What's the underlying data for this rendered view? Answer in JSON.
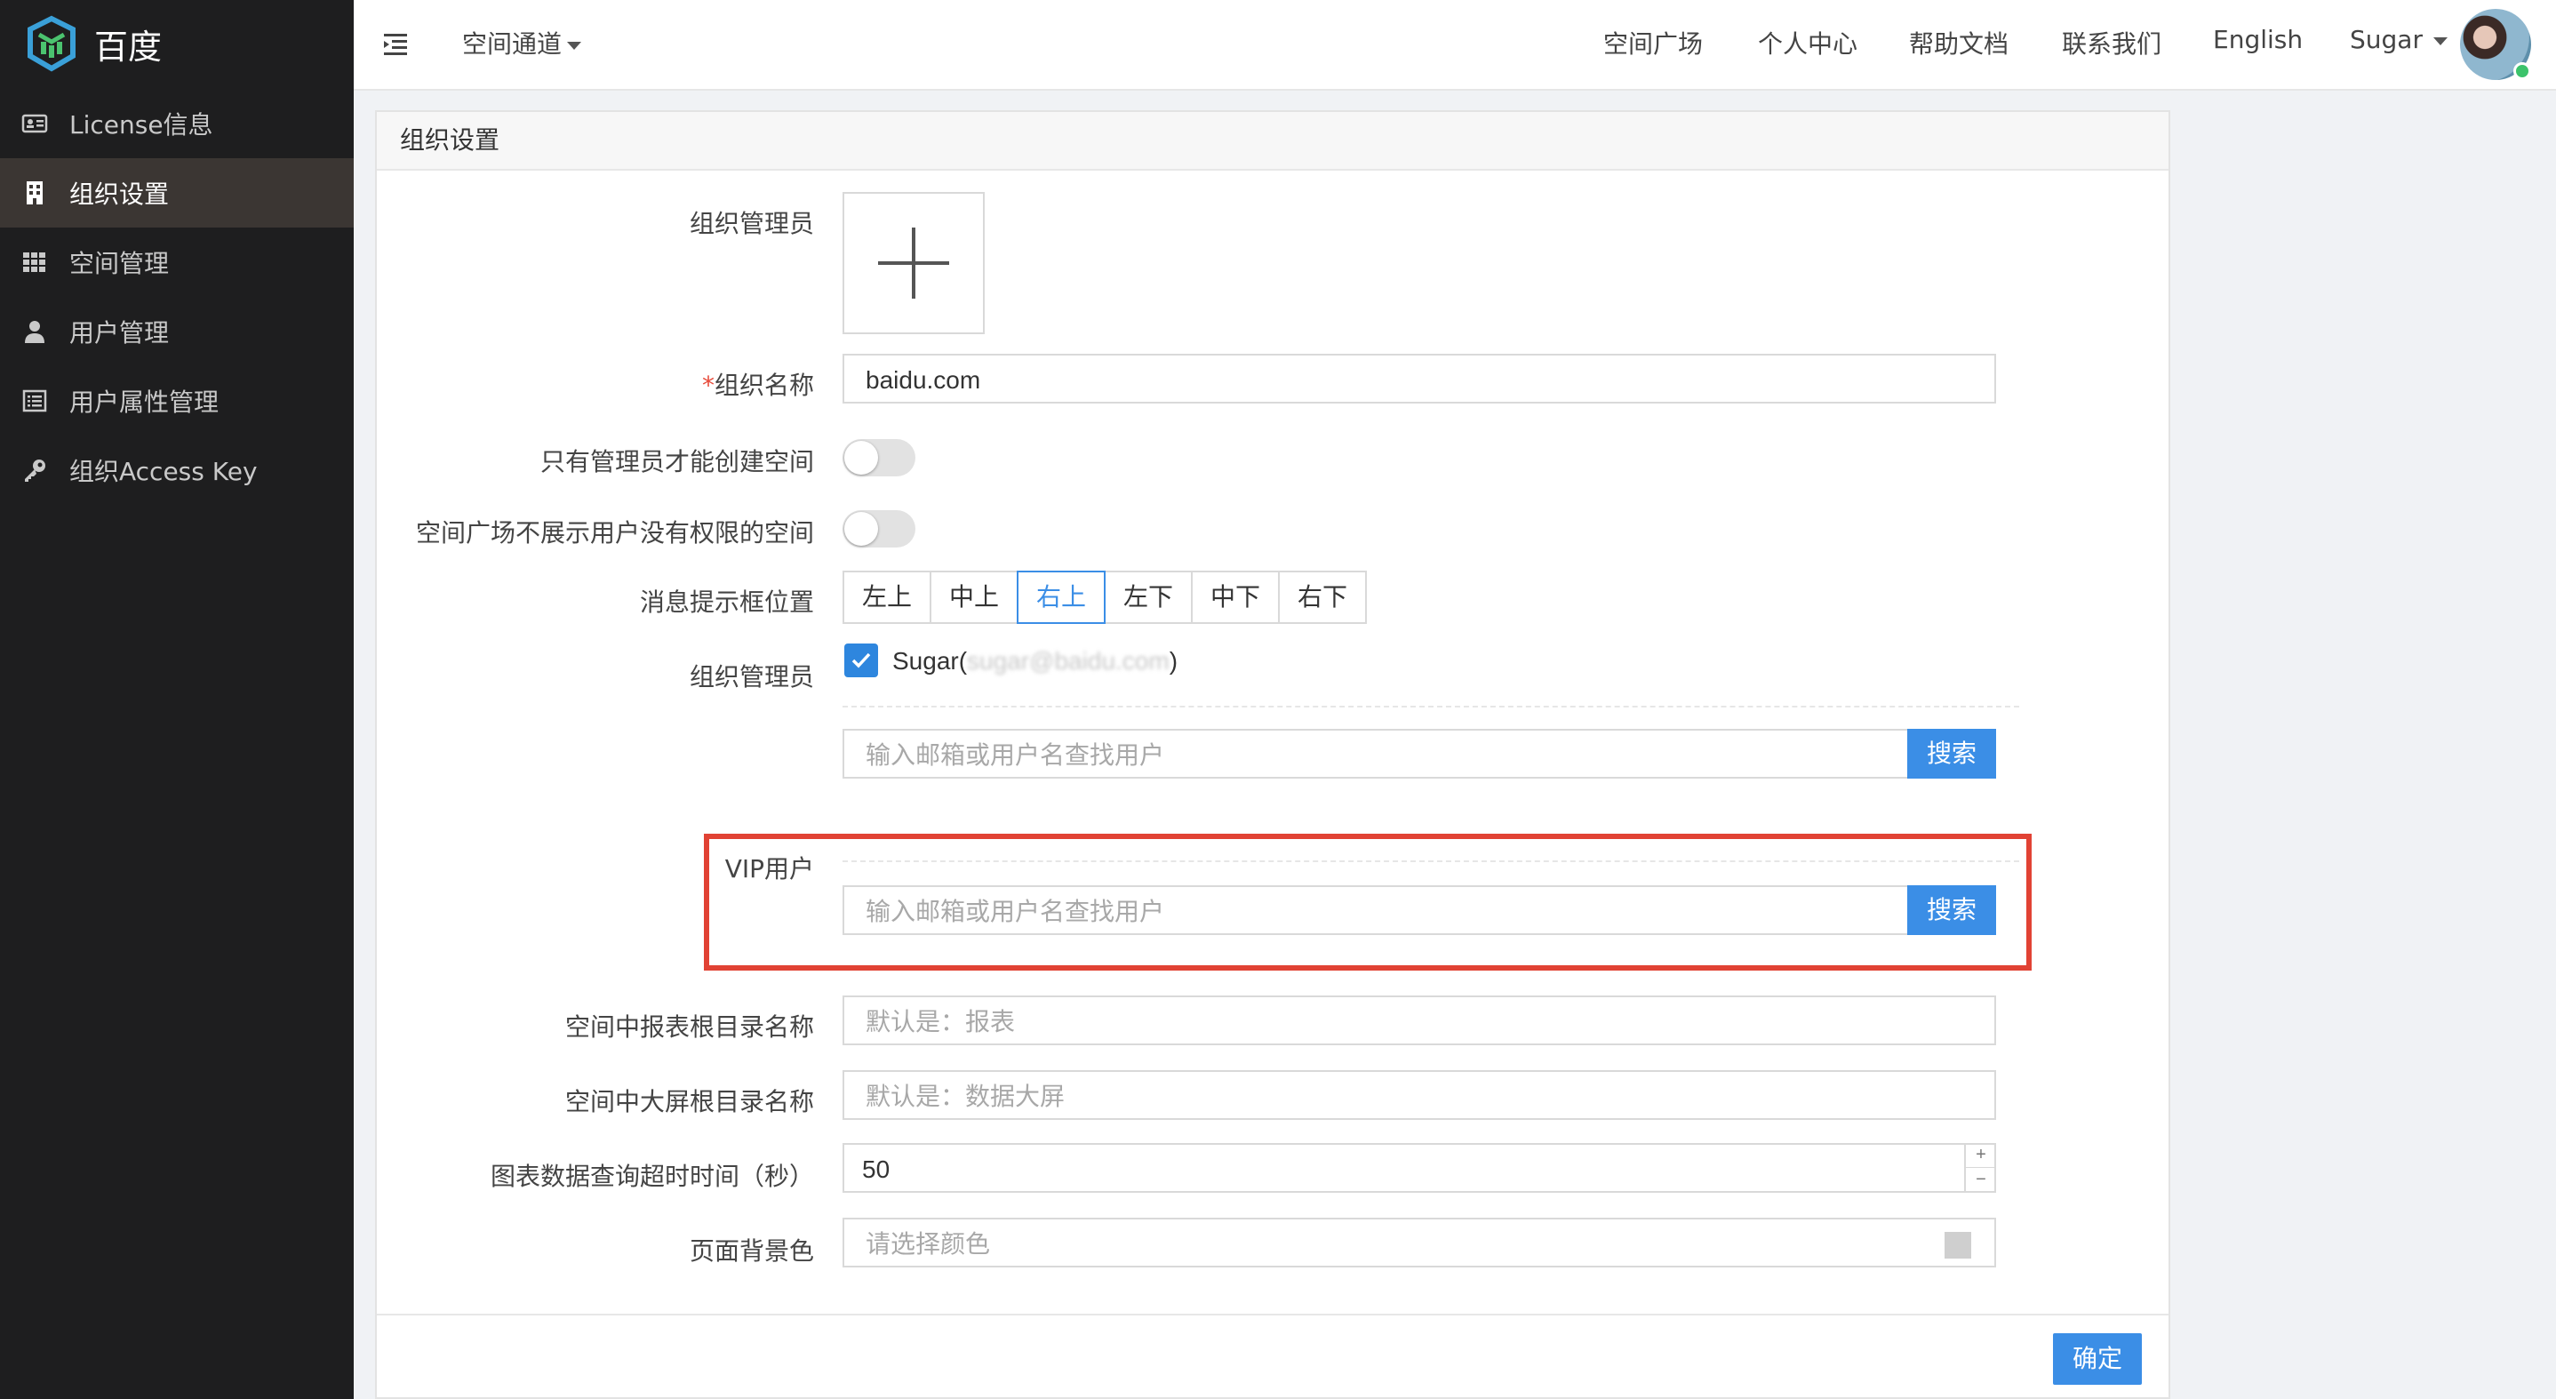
{
  "brand": {
    "name": "百度",
    "logo_icon": "cube-logo-icon"
  },
  "sidebar": {
    "items": [
      {
        "label": "License信息",
        "icon": "id-card-icon"
      },
      {
        "label": "组织设置",
        "icon": "building-icon",
        "active": true
      },
      {
        "label": "空间管理",
        "icon": "grid-icon"
      },
      {
        "label": "用户管理",
        "icon": "user-icon"
      },
      {
        "label": "用户属性管理",
        "icon": "list-icon"
      },
      {
        "label": "组织Access Key",
        "icon": "key-icon"
      }
    ]
  },
  "topbar": {
    "channel_label": "空间通道",
    "nav": [
      "空间广场",
      "个人中心",
      "帮助文档",
      "联系我们",
      "English"
    ],
    "user_name": "Sugar"
  },
  "panel": {
    "title": "组织设置",
    "admin_avatar_label": "组织管理员",
    "org_name_label": "组织名称",
    "org_name_required_mark": "*",
    "org_name_value": "baidu.com",
    "only_admin_create_label": "只有管理员才能创建空间",
    "hide_noperm_label": "空间广场不展示用户没有权限的空间",
    "msg_position_label": "消息提示框位置",
    "msg_positions": [
      "左上",
      "中上",
      "右上",
      "左下",
      "中下",
      "右下"
    ],
    "msg_position_selected": "右上",
    "admins_label": "组织管理员",
    "admin_user_name": "Sugar(",
    "admin_user_email": "sugar@baidu.com",
    "admin_user_close": ")",
    "admin_search_placeholder": "输入邮箱或用户名查找用户",
    "admin_search_button": "搜索",
    "vip_label": "VIP用户",
    "vip_search_placeholder": "输入邮箱或用户名查找用户",
    "vip_search_button": "搜索",
    "report_root_label": "空间中报表根目录名称",
    "report_root_placeholder": "默认是：报表",
    "screen_root_label": "空间中大屏根目录名称",
    "screen_root_placeholder": "默认是：数据大屏",
    "timeout_label": "图表数据查询超时时间（秒）",
    "timeout_value": "50",
    "bg_color_label": "页面背景色",
    "bg_color_placeholder": "请选择颜色",
    "confirm_button": "确定"
  },
  "colors": {
    "accent": "#3b8ee6",
    "highlight": "#e14234",
    "sidebar_bg": "#1e1e1f"
  }
}
